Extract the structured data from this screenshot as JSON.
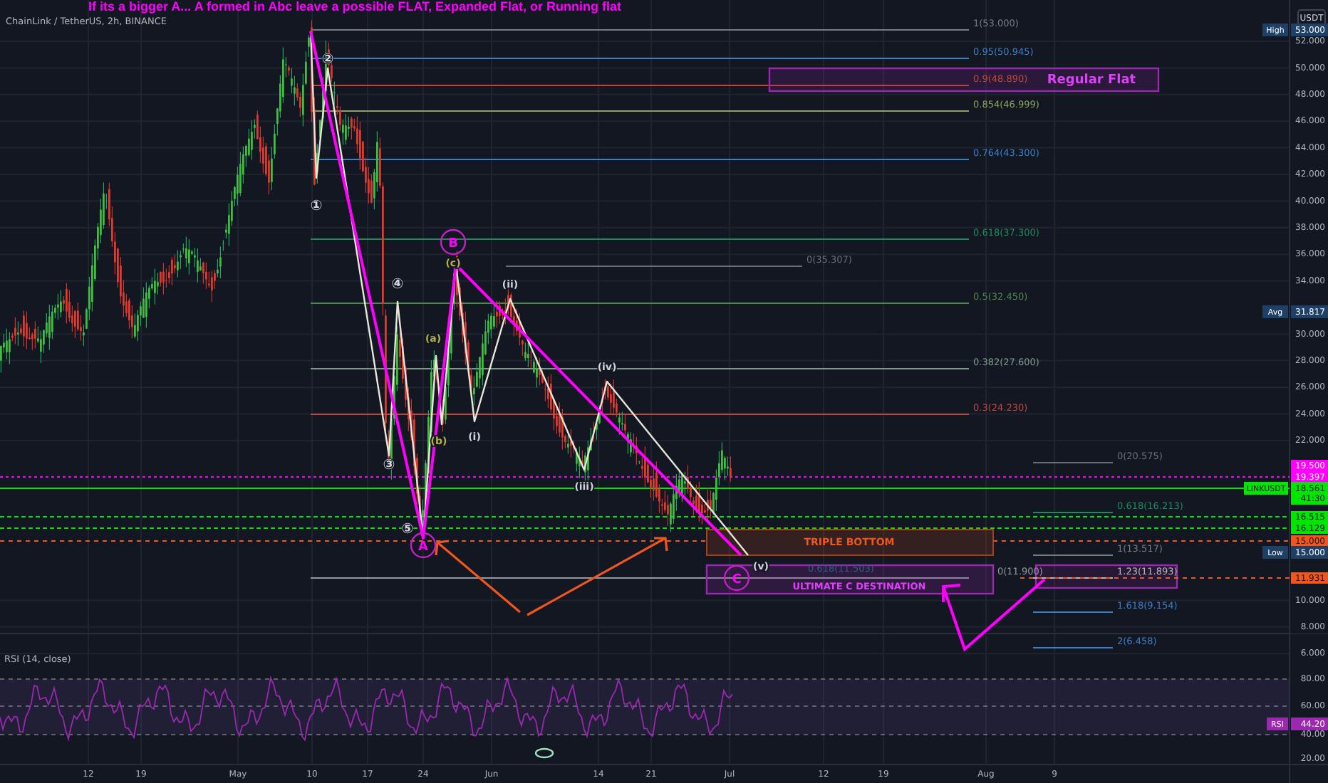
{
  "chart_header": {
    "title": "If its a bigger A... A formed in Abc leave a possible FLAT, Expanded Flat, or Running flat",
    "symbol": "ChainLink / TetherUS, 2h, BINANCE"
  },
  "price_axis": {
    "unit": "USDT",
    "ticks": [
      "52.000",
      "50.000",
      "48.000",
      "46.000",
      "44.000",
      "42.000",
      "40.000",
      "38.000",
      "36.000",
      "34.000",
      "30.000",
      "28.000",
      "26.000",
      "24.000",
      "22.000",
      "10.000",
      "8.000",
      "6.000"
    ]
  },
  "price_tags": [
    {
      "kind": "marker",
      "name": "High",
      "value": "53.000",
      "color": "#1e3f66"
    },
    {
      "kind": "marker",
      "name": "Avg",
      "value": "31.817",
      "color": "#1e3f66"
    },
    {
      "kind": "plain",
      "value": "19.500",
      "color": "#ff00ff"
    },
    {
      "kind": "plain",
      "value": "19.397",
      "color": "#ff00ff"
    },
    {
      "kind": "symbol",
      "name": "LINKUSDT",
      "value": "18.561",
      "countdown": "41:30",
      "color": "#00e600"
    },
    {
      "kind": "plain",
      "value": "16.515",
      "color": "#00e600"
    },
    {
      "kind": "plain",
      "value": "16.129",
      "color": "#00e600"
    },
    {
      "kind": "plain",
      "value": "15.000",
      "color": "#f0561d"
    },
    {
      "kind": "marker",
      "name": "Low",
      "value": "15.000",
      "color": "#1e3f66"
    },
    {
      "kind": "plain",
      "value": "11.931",
      "color": "#f0561d"
    }
  ],
  "fib_levels": [
    {
      "label": "1(53.000)",
      "color": "#787b86"
    },
    {
      "label": "0.95(50.945)",
      "color": "#3b7fc4"
    },
    {
      "label": "0.9(48.890)",
      "color": "#c0453a"
    },
    {
      "label": "0.854(46.999)",
      "color": "#8fa05e"
    },
    {
      "label": "0.764(43.300)",
      "color": "#3b7fc4"
    },
    {
      "label": "0.618(37.300)",
      "color": "#1f8a5e"
    },
    {
      "label": "0(35.307)",
      "color": "#6a6d78"
    },
    {
      "label": "0.5(32.450)",
      "color": "#4b8a4b"
    },
    {
      "label": "0.382(27.600)",
      "color": "#7f9a88"
    },
    {
      "label": "0.3(24.230)",
      "color": "#c0453a"
    },
    {
      "label": "0(20.575)",
      "color": "#6a6d78"
    },
    {
      "label": "0.618(16.213)",
      "color": "#1f8a5e"
    },
    {
      "label": "1(13.517)",
      "color": "#787b86"
    },
    {
      "label": "0.618(11.503)",
      "color": "#2f5f8a"
    },
    {
      "label": "0(11.900)",
      "color": "#9598a1"
    },
    {
      "label": "1.23(11.893)",
      "color": "#b8b8b8"
    },
    {
      "label": "1.618(9.154)",
      "color": "#3b7fc4"
    },
    {
      "label": "2(6.458)",
      "color": "#3b7fc4"
    }
  ],
  "wave_labels": [
    {
      "text": "①",
      "color": "#d1d4dc"
    },
    {
      "text": "②",
      "color": "#d1d4dc"
    },
    {
      "text": "③",
      "color": "#d1d4dc"
    },
    {
      "text": "④",
      "color": "#d1d4dc"
    },
    {
      "text": "⑤",
      "color": "#d1d4dc"
    },
    {
      "text": "(a)",
      "color": "#b5b04a"
    },
    {
      "text": "(b)",
      "color": "#b5b04a"
    },
    {
      "text": "(c)",
      "color": "#b5b04a"
    },
    {
      "text": "(i)",
      "color": "#d1d4dc"
    },
    {
      "text": "(ii)",
      "color": "#d1d4dc"
    },
    {
      "text": "(iii)",
      "color": "#d1d4dc"
    },
    {
      "text": "(iv)",
      "color": "#d1d4dc"
    },
    {
      "text": "(v)",
      "color": "#d1d4dc"
    }
  ],
  "circled_labels": [
    "A",
    "B",
    "C"
  ],
  "zones": [
    {
      "kind": "flat",
      "text": "Regular Flat"
    },
    {
      "kind": "bottom",
      "text": "TRIPLE BOTTOM"
    },
    {
      "kind": "target",
      "text": "ULTIMATE C DESTINATION"
    }
  ],
  "rsi": {
    "label": "RSI (14, close)",
    "name": "RSI",
    "value": "44.20",
    "ticks": [
      "80.00",
      "60.00",
      "40.00",
      "20.00"
    ]
  },
  "time_axis": [
    "12",
    "19",
    "May",
    "10",
    "17",
    "24",
    "Jun",
    "14",
    "21",
    "Jul",
    "12",
    "19",
    "Aug",
    "9"
  ]
}
